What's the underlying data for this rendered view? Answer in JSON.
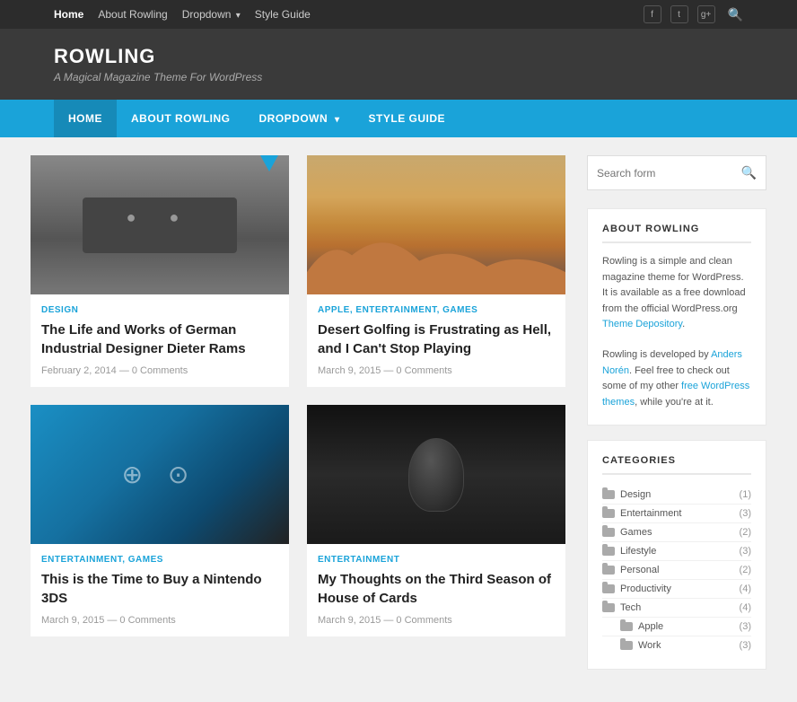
{
  "site": {
    "title": "ROWLING",
    "tagline": "A Magical Magazine Theme For WordPress"
  },
  "topNav": {
    "items": [
      {
        "label": "Home",
        "active": true
      },
      {
        "label": "About Rowling",
        "active": false
      },
      {
        "label": "Dropdown",
        "hasDropdown": true,
        "active": false
      },
      {
        "label": "Style Guide",
        "active": false
      }
    ]
  },
  "mainNav": {
    "items": [
      {
        "label": "HOME",
        "active": true
      },
      {
        "label": "ABOUT ROWLING",
        "active": false
      },
      {
        "label": "DROPDOWN",
        "hasDropdown": true,
        "active": false
      },
      {
        "label": "STYLE GUIDE",
        "active": false
      }
    ]
  },
  "posts": [
    {
      "id": "post1",
      "imageType": "cassette",
      "hasBookmark": true,
      "category": "DESIGN",
      "title": "The Life and Works of German Industrial Designer Dieter Rams",
      "date": "February 2, 2014",
      "comments": "0 Comments"
    },
    {
      "id": "post2",
      "imageType": "desert",
      "hasBookmark": false,
      "category": "APPLE, ENTERTAINMENT, GAMES",
      "title": "Desert Golfing is Frustrating as Hell, and I Can't Stop Playing",
      "date": "March 9, 2015",
      "comments": "0 Comments"
    },
    {
      "id": "post3",
      "imageType": "controller",
      "hasBookmark": false,
      "category": "ENTERTAINMENT, GAMES",
      "title": "This is the Time to Buy a Nintendo 3DS",
      "date": "March 9, 2015",
      "comments": "0 Comments"
    },
    {
      "id": "post4",
      "imageType": "hoc",
      "hasBookmark": false,
      "category": "ENTERTAINMENT",
      "title": "My Thoughts on the Third Season of House of Cards",
      "date": "March 9, 2015",
      "comments": "0 Comments"
    }
  ],
  "search": {
    "placeholder": "Search form"
  },
  "aboutWidget": {
    "title": "ABOUT ROWLING",
    "text1": "Rowling is a simple and clean magazine theme for WordPress. It is available as a free download from the official WordPress.org ",
    "link1": "Theme Depository",
    "text2": ". Rowling is developed by ",
    "link2": "Anders Norén",
    "text3": ". Feel free to check out some of my other ",
    "link3": "free WordPress themes",
    "text4": ", while you're at it."
  },
  "categoriesWidget": {
    "title": "CATEGORIES",
    "categories": [
      {
        "name": "Design",
        "count": "(1)",
        "sub": false
      },
      {
        "name": "Entertainment",
        "count": "(3)",
        "sub": false
      },
      {
        "name": "Games",
        "count": "(2)",
        "sub": false
      },
      {
        "name": "Lifestyle",
        "count": "(3)",
        "sub": false
      },
      {
        "name": "Personal",
        "count": "(2)",
        "sub": false
      },
      {
        "name": "Productivity",
        "count": "(4)",
        "sub": false
      },
      {
        "name": "Tech",
        "count": "(4)",
        "sub": false
      },
      {
        "name": "Apple",
        "count": "(3)",
        "sub": true
      },
      {
        "name": "Work",
        "count": "(3)",
        "sub": true
      }
    ]
  },
  "social": {
    "icons": [
      "f",
      "t",
      "g+",
      "🔍"
    ]
  }
}
